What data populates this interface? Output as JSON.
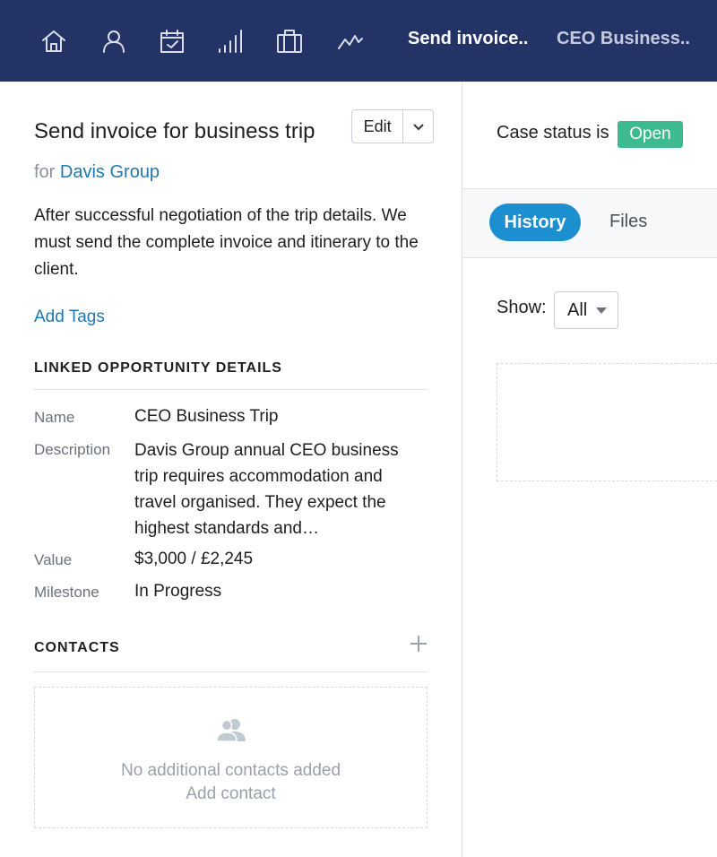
{
  "nav": {
    "icons": [
      "home-icon",
      "person-icon",
      "calendar-icon",
      "signal-bars-icon",
      "briefcase-icon",
      "activity-icon"
    ],
    "tabs": [
      {
        "label": "Send invoice..",
        "active": true
      },
      {
        "label": "CEO Business..",
        "active": false
      }
    ],
    "background_color": "#243365"
  },
  "case": {
    "title": "Send invoice for business trip",
    "edit_label": "Edit",
    "for_word": "for",
    "organization": "Davis Group",
    "description": "After successful negotiation of the trip details. We must send the complete invoice and itinerary to the client.",
    "add_tags_label": "Add Tags"
  },
  "opportunity": {
    "heading": "LINKED OPPORTUNITY DETAILS",
    "name_label": "Name",
    "name_value": "CEO Business Trip",
    "description_label": "Description",
    "description_value": "Davis Group annual CEO business trip requires accommodation and travel organised. They expect the highest standards and…",
    "value_label": "Value",
    "value_value": "$3,000 / £2,245",
    "milestone_label": "Milestone",
    "milestone_value": "In Progress"
  },
  "contacts": {
    "heading": "CONTACTS",
    "empty_text": "No additional contacts added",
    "add_contact_label": "Add contact"
  },
  "status": {
    "label": "Case status is",
    "badge": "Open",
    "badge_color": "#3fba8e"
  },
  "right_tabs": [
    {
      "label": "History",
      "active": true
    },
    {
      "label": "Files",
      "active": false
    }
  ],
  "filter": {
    "show_label": "Show:",
    "selected": "All"
  },
  "colors": {
    "link": "#1f78b4",
    "accent": "#1b8fcf"
  }
}
